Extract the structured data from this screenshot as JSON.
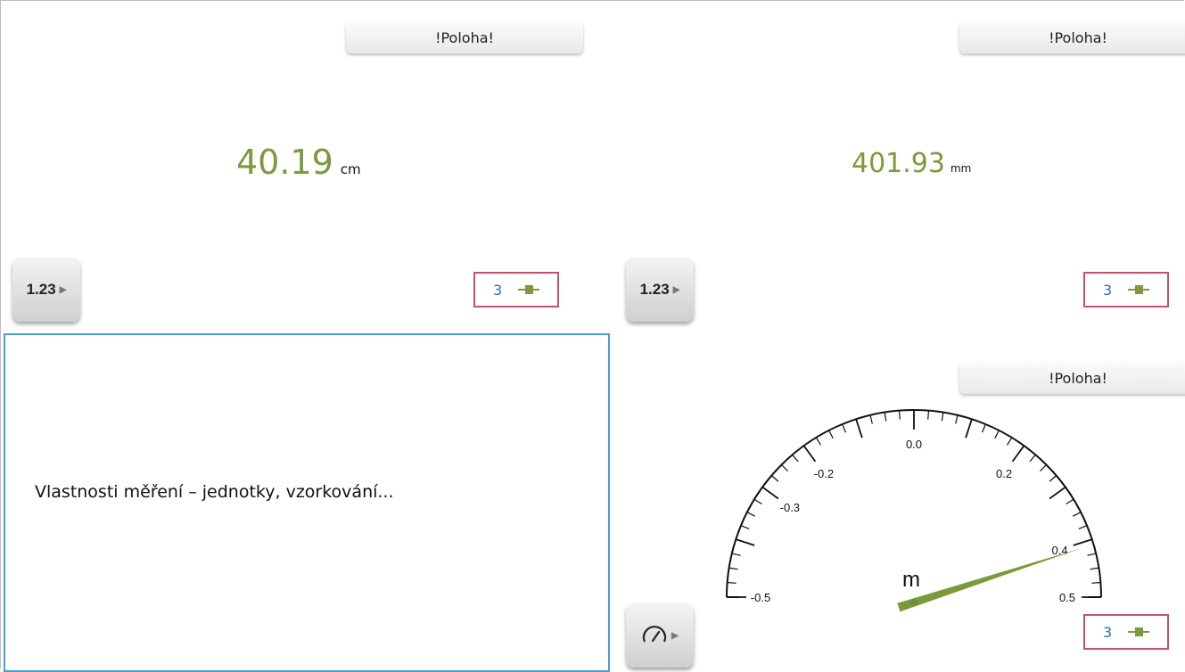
{
  "panels": [
    {
      "title": "!Poloha!",
      "value": "40.19",
      "unit": "cm",
      "mode_label": "1.23",
      "channel": "3"
    },
    {
      "title": "!Poloha!",
      "value": "401.93",
      "unit": "mm",
      "mode_label": "1.23",
      "channel": "3"
    }
  ],
  "text_panel": {
    "label": "Vlastnosti měření – jednotky, vzorkování..."
  },
  "gauge": {
    "title": "!Poloha!",
    "unit": "m",
    "channel": "3",
    "tick_labels": [
      "-0.5",
      "-0.3",
      "-0.2",
      "0.0",
      "0.2",
      "0.4",
      "0.5"
    ],
    "min": -0.5,
    "max": 0.5,
    "value": 0.4
  },
  "colors": {
    "value": "#7a9a3c",
    "sensor_border": "#c9506c",
    "panel_border": "#4a9fd0",
    "channel_text": "#2d6fb0"
  },
  "icons": {
    "gauge_mode": "speedometer-icon",
    "plug": "plug-icon",
    "mode_arrow": "triangle-right-icon"
  }
}
